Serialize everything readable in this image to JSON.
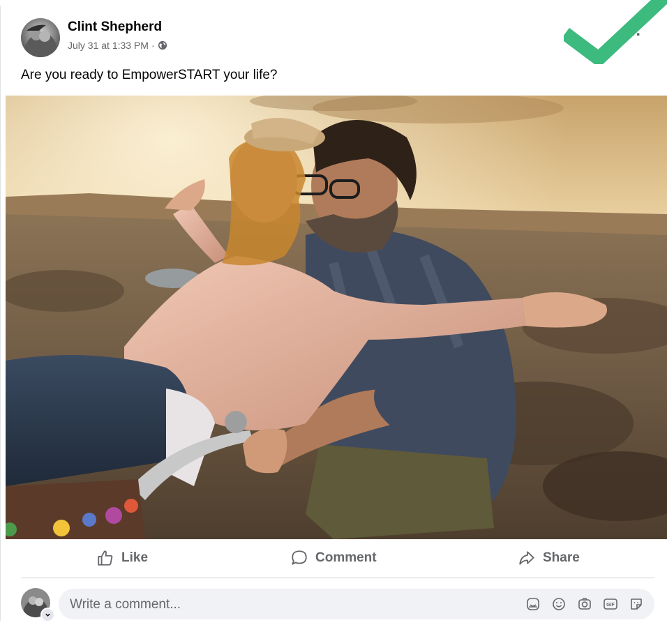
{
  "post": {
    "author": "Clint Shepherd",
    "timestamp": "July 31 at 1:33 PM",
    "separator": "·",
    "privacy_icon": "globe-icon",
    "more_label": "...",
    "text": "Are you ready to EmpowerSTART your life?",
    "photo_alt": "photo"
  },
  "overlay": {
    "check_icon": "checkmark-icon",
    "check_color": "#3dba7e"
  },
  "actions": {
    "like_label": "Like",
    "comment_label": "Comment",
    "share_label": "Share"
  },
  "comment_composer": {
    "placeholder": "Write a comment...",
    "icons": [
      "sticker-face-icon",
      "emoji-icon",
      "camera-icon",
      "gif-icon",
      "sticker-icon"
    ]
  },
  "colors": {
    "secondary_text": "#65676b",
    "composer_bg": "#f0f2f5"
  }
}
